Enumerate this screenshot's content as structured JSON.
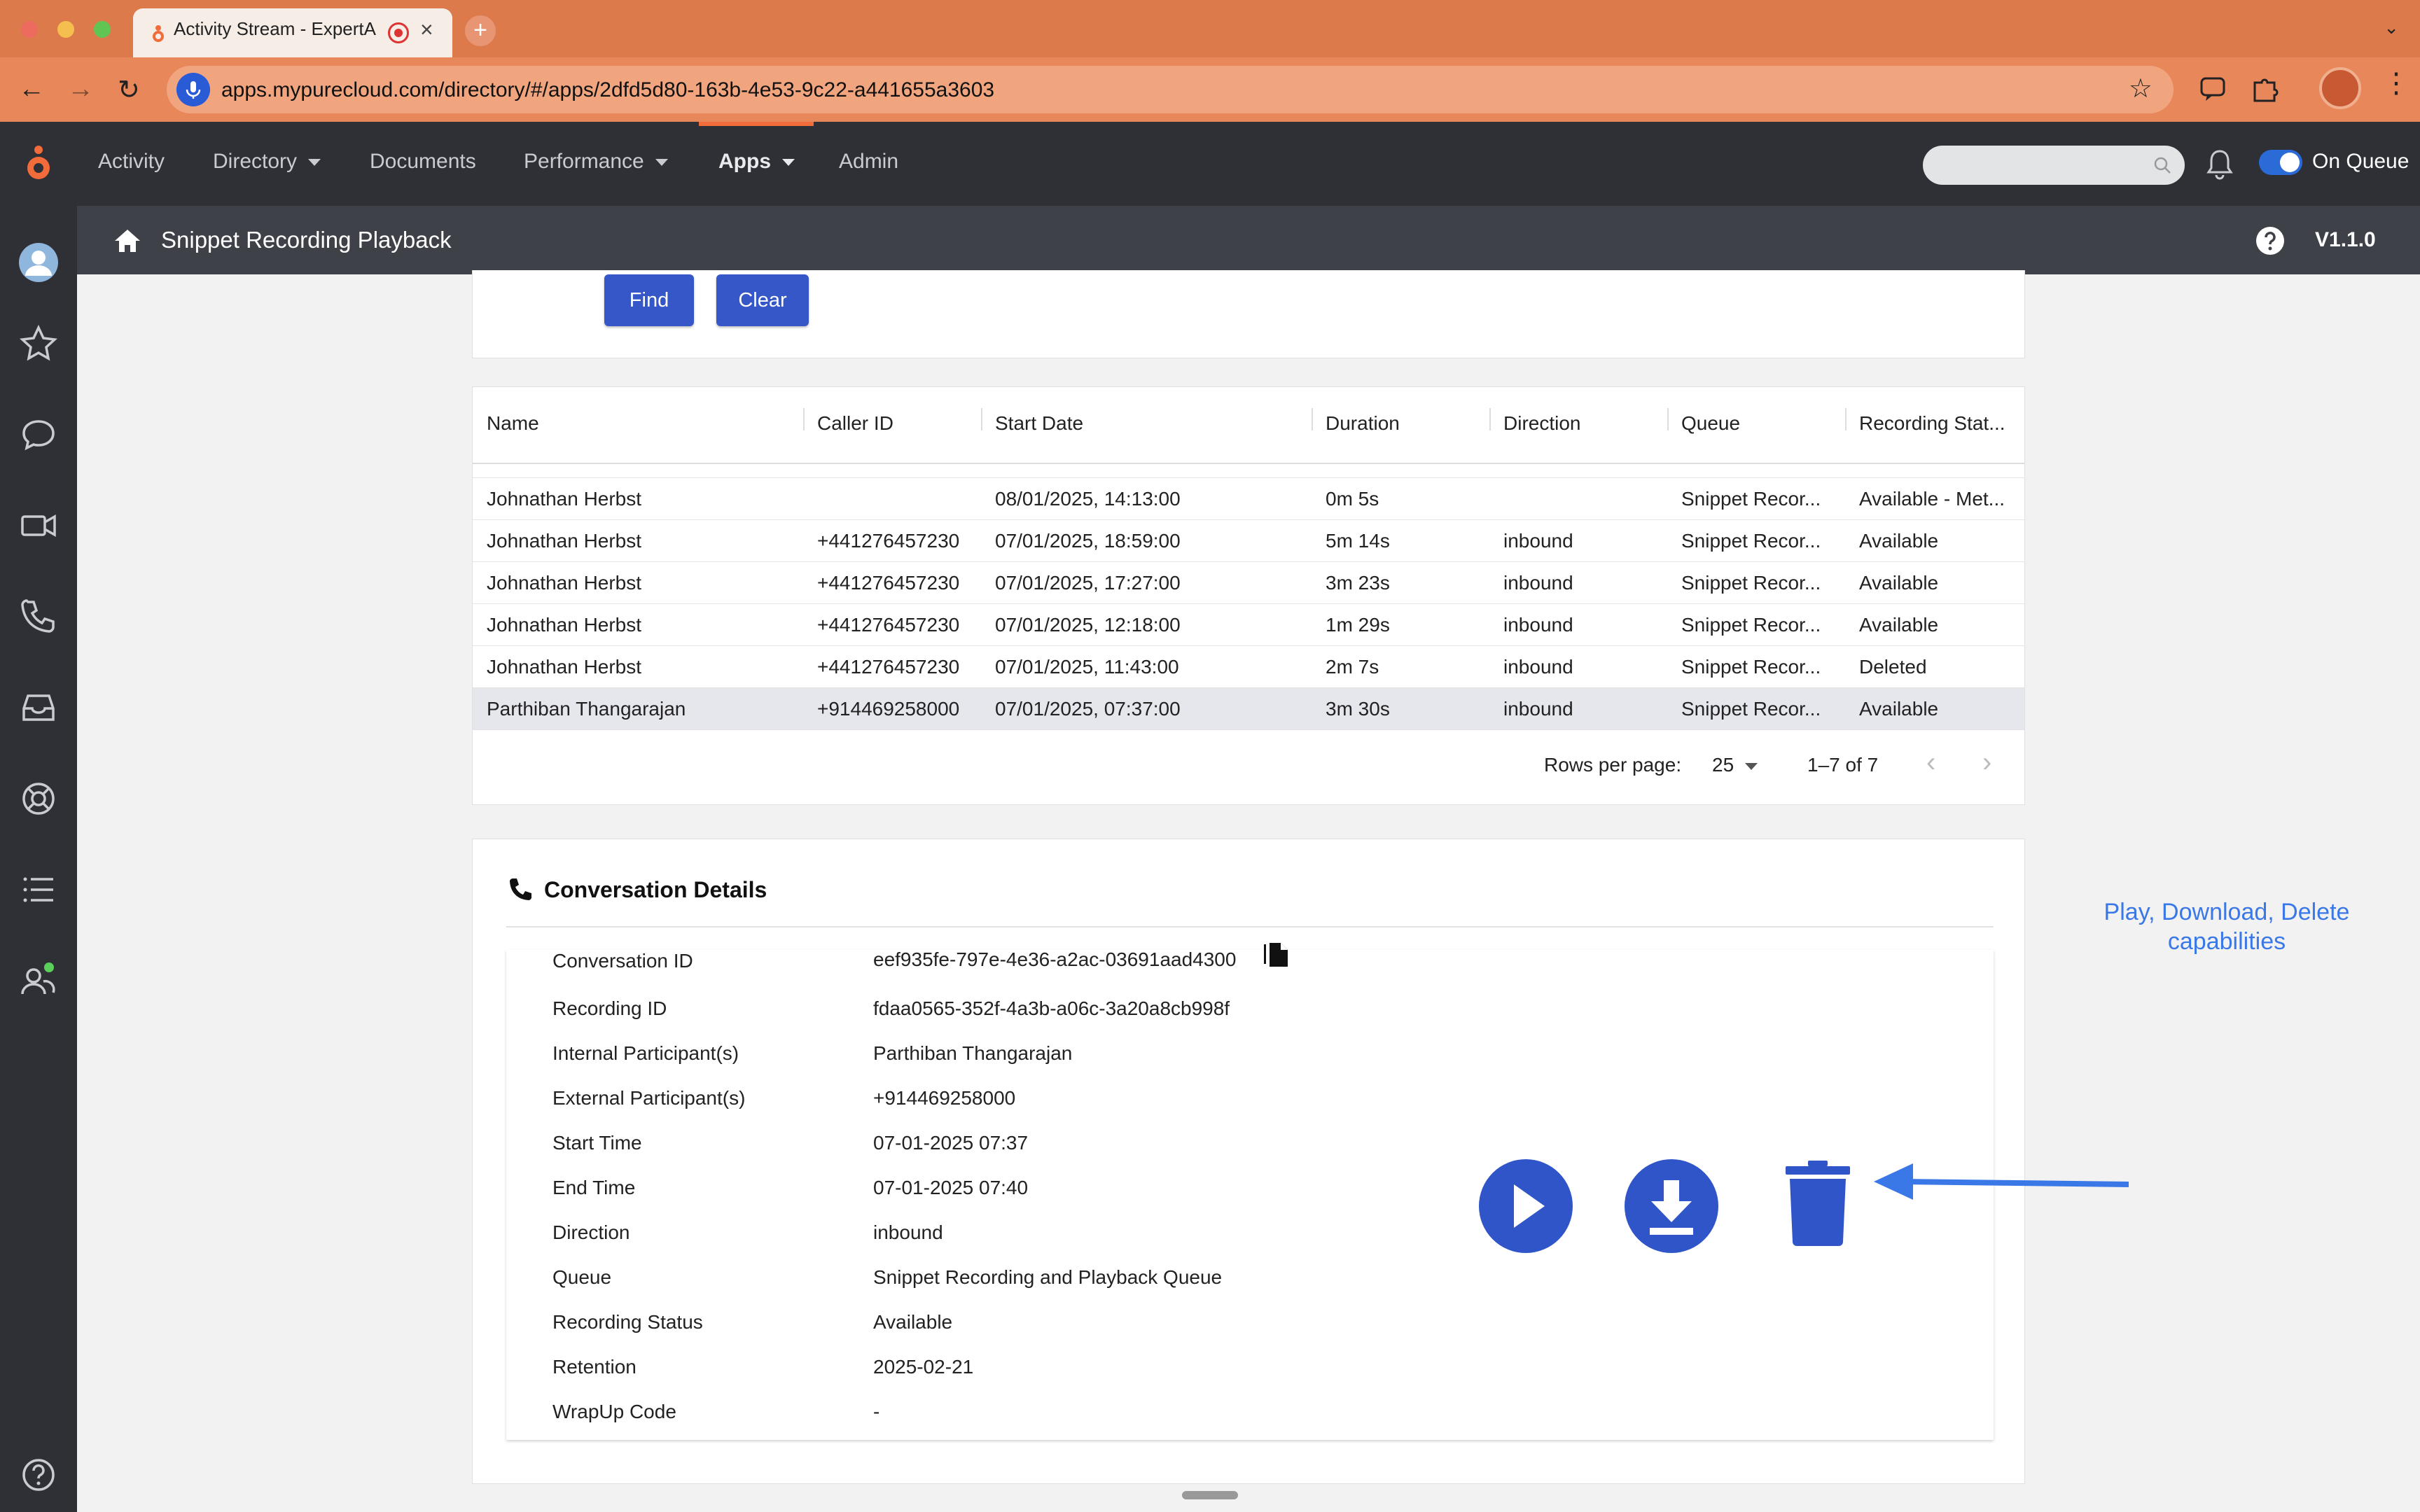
{
  "browser": {
    "tab_title": "Activity Stream - ExpertA",
    "url": "apps.mypurecloud.com/directory/#/apps/2dfd5d80-163b-4e53-9c22-a441655a3603"
  },
  "nav": {
    "items": [
      "Activity",
      "Directory",
      "Documents",
      "Performance",
      "Apps",
      "Admin"
    ],
    "status": "On Queue"
  },
  "app": {
    "title": "Snippet Recording Playback",
    "version": "V1.1.0"
  },
  "search": {
    "find_label": "Find",
    "clear_label": "Clear"
  },
  "table": {
    "headers": [
      "Name",
      "Caller ID",
      "Start Date",
      "Duration",
      "Direction",
      "Queue",
      "Recording Stat..."
    ],
    "rows": [
      [
        "Johnathan Herbst",
        "",
        "08/01/2025, 14:13:00",
        "0m 5s",
        "",
        "Snippet Recor...",
        "Available - Met..."
      ],
      [
        "Johnathan Herbst",
        "+441276457230",
        "07/01/2025, 18:59:00",
        "5m 14s",
        "inbound",
        "Snippet Recor...",
        "Available"
      ],
      [
        "Johnathan Herbst",
        "+441276457230",
        "07/01/2025, 17:27:00",
        "3m 23s",
        "inbound",
        "Snippet Recor...",
        "Available"
      ],
      [
        "Johnathan Herbst",
        "+441276457230",
        "07/01/2025, 12:18:00",
        "1m 29s",
        "inbound",
        "Snippet Recor...",
        "Available"
      ],
      [
        "Johnathan Herbst",
        "+441276457230",
        "07/01/2025, 11:43:00",
        "2m 7s",
        "inbound",
        "Snippet Recor...",
        "Deleted"
      ],
      [
        "Parthiban Thangarajan",
        "+914469258000",
        "07/01/2025, 07:37:00",
        "3m 30s",
        "inbound",
        "Snippet Recor...",
        "Available"
      ]
    ],
    "selected_row": 5,
    "pagination": {
      "rows_per_page_label": "Rows per page:",
      "rows_per_page": "25",
      "range": "1–7 of 7"
    }
  },
  "details": {
    "title": "Conversation Details",
    "fields": [
      {
        "label": "Conversation ID",
        "value": "eef935fe-797e-4e36-a2ac-03691aad4300"
      },
      {
        "label": "Recording ID",
        "value": "fdaa0565-352f-4a3b-a06c-3a20a8cb998f"
      },
      {
        "label": "Internal Participant(s)",
        "value": "Parthiban Thangarajan"
      },
      {
        "label": "External Participant(s)",
        "value": "+914469258000"
      },
      {
        "label": "Start Time",
        "value": "07-01-2025 07:37"
      },
      {
        "label": "End Time",
        "value": "07-01-2025 07:40"
      },
      {
        "label": "Direction",
        "value": "inbound"
      },
      {
        "label": "Queue",
        "value": "Snippet Recording and Playback Queue"
      },
      {
        "label": "Recording Status",
        "value": "Available"
      },
      {
        "label": "Retention",
        "value": "2025-02-21"
      },
      {
        "label": "WrapUp Code",
        "value": "-"
      }
    ]
  },
  "annotation": {
    "line1": "Play, Download, Delete",
    "line2": "capabilities"
  },
  "colors": {
    "accent": "#3557c8",
    "nav_bg": "#2e3036",
    "browser_bar": "#dd7a4c",
    "annotation": "#3b78e7"
  }
}
